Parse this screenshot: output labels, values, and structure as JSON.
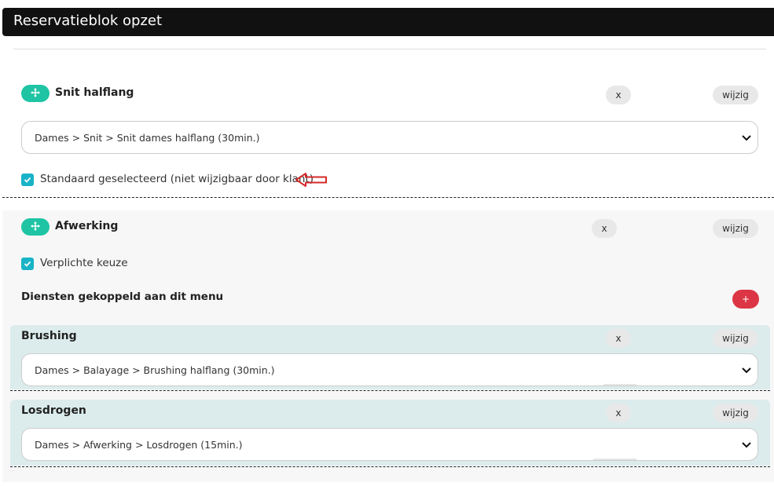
{
  "header": {
    "title": "Reservatieblok opzet"
  },
  "block1": {
    "title": "Snit halflang",
    "remove_label": "x",
    "edit_label": "wijzig",
    "select_value": "Dames > Snit > Snit dames halflang (30min.)",
    "checkbox_label": "Standaard geselecteerd (niet wijzigbaar door klant)"
  },
  "block2": {
    "title": "Afwerking",
    "remove_label": "x",
    "edit_label": "wijzig",
    "checkbox_label": "Verplichte keuze",
    "services_heading": "Diensten gekoppeld aan dit menu",
    "add_label": "+",
    "services": [
      {
        "title": "Brushing",
        "remove_label": "x",
        "edit_label": "wijzig",
        "select_value": "Dames > Balayage > Brushing halflang (30min.)"
      },
      {
        "title": "Losdrogen",
        "remove_label": "x",
        "edit_label": "wijzig",
        "select_value": "Dames > Afwerking > Losdrogen (15min.)"
      }
    ]
  },
  "colors": {
    "accent": "#1ec4a4",
    "checkbox": "#19b3c7",
    "danger": "#dc3545",
    "header": "#111111",
    "subpanel": "#dcecec"
  }
}
